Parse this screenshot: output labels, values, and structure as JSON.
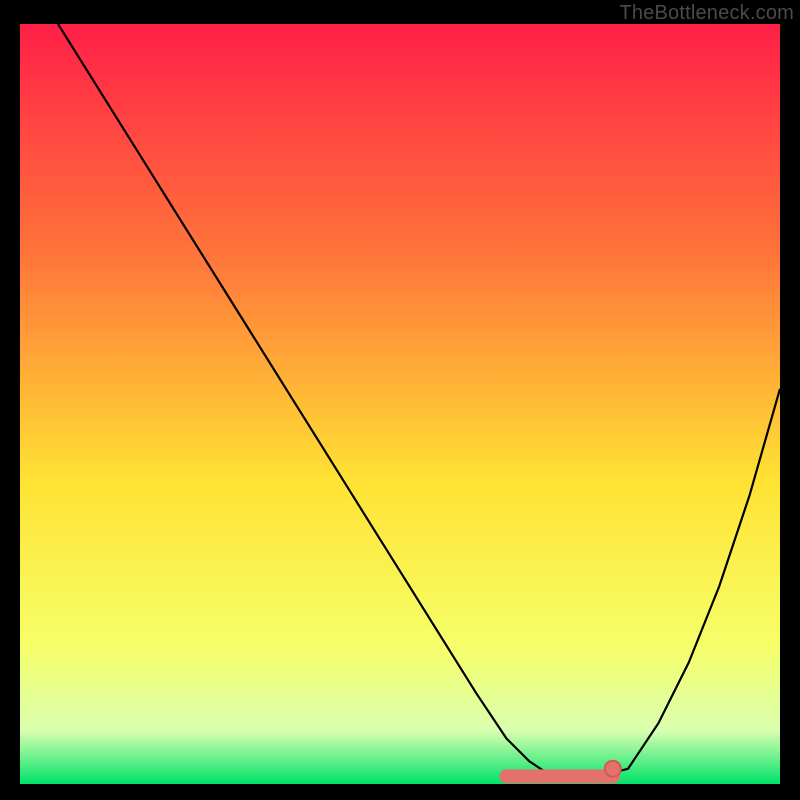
{
  "watermark": "TheBottleneck.com",
  "colors": {
    "gradient_top": "#ff1f47",
    "gradient_mid_upper": "#ff7a3a",
    "gradient_mid": "#ffe233",
    "gradient_lower": "#f6ff6a",
    "gradient_near_bottom": "#d9ffb0",
    "gradient_bottom": "#00e26a",
    "curve": "#000000",
    "marker_fill": "#e5716d",
    "marker_stroke": "#d35a56",
    "frame": "#000000"
  },
  "chart_data": {
    "type": "line",
    "title": "",
    "xlabel": "",
    "ylabel": "",
    "xlim": [
      0,
      100
    ],
    "ylim": [
      0,
      100
    ],
    "grid": false,
    "legend": false,
    "annotations": [],
    "series": [
      {
        "name": "bottleneck-curve",
        "x": [
          5,
          10,
          15,
          20,
          25,
          30,
          35,
          40,
          45,
          50,
          55,
          60,
          64,
          67,
          70,
          73,
          76,
          80,
          84,
          88,
          92,
          96,
          100
        ],
        "y": [
          100,
          92,
          84,
          76,
          68,
          60,
          52,
          44,
          36,
          28,
          20,
          12,
          6,
          3,
          1,
          1,
          1,
          2,
          8,
          16,
          26,
          38,
          52
        ]
      }
    ],
    "markers": [
      {
        "name": "flat-region-track",
        "x_range": [
          64,
          78
        ],
        "y": 1
      },
      {
        "name": "endpoint-dot",
        "x": 78,
        "y": 2
      }
    ]
  }
}
